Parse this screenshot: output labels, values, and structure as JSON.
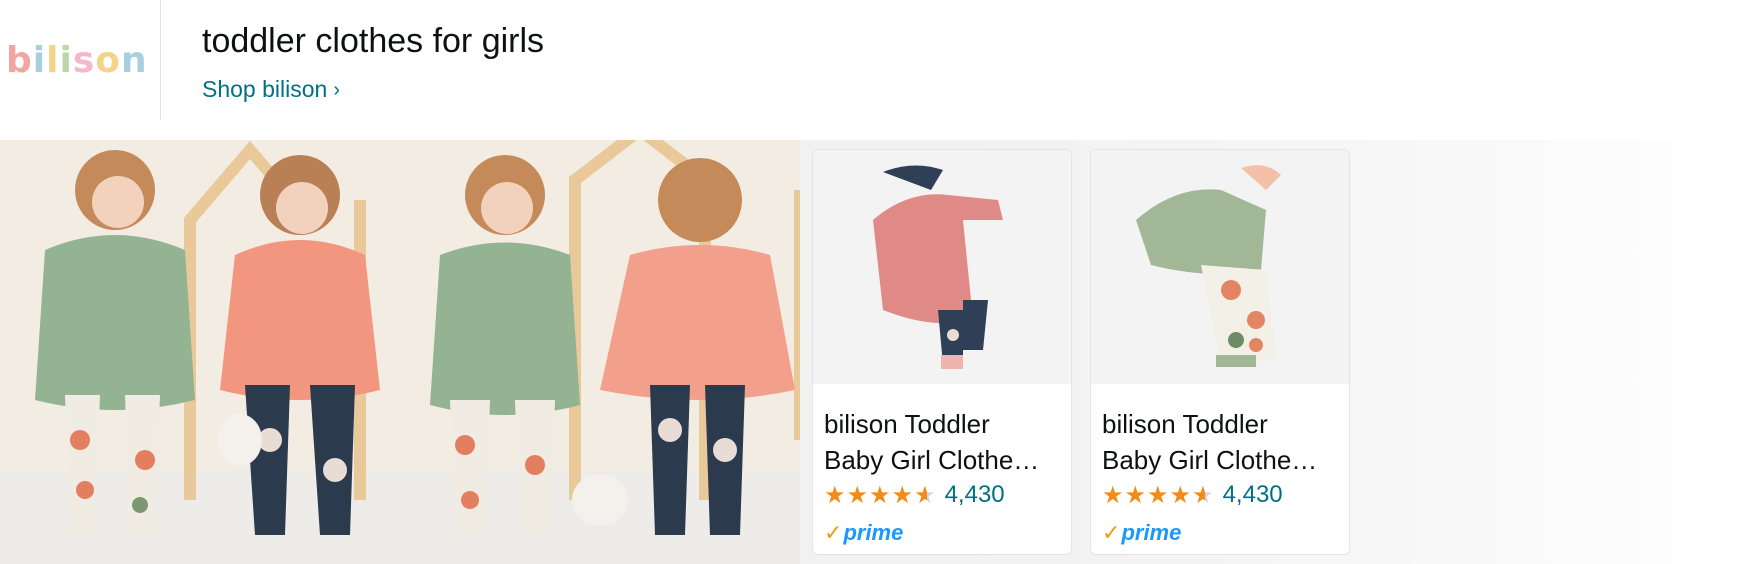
{
  "brand": {
    "logo_text": "bilison",
    "colors": [
      "#f0a7a0",
      "#a8cfe0",
      "#f2d48a",
      "#b9d7a8",
      "#f4b9c8",
      "#f2d48a",
      "#a8cfe0"
    ]
  },
  "header": {
    "title": "toddler clothes for girls",
    "shop_link": "Shop bilison",
    "shop_icon": "chevron-right-icon"
  },
  "hero": {
    "icon": "lifestyle-photo"
  },
  "products": [
    {
      "title_line1": "bilison Toddler",
      "title_line2": "Baby Girl Clothe…",
      "rating": 4.5,
      "review_count": "4,430",
      "prime": "prime",
      "image": "pink-dress-outfit"
    },
    {
      "title_line1": "bilison Toddler",
      "title_line2": "Baby Girl Clothe…",
      "rating": 4.5,
      "review_count": "4,430",
      "prime": "prime",
      "image": "green-dress-outfit"
    }
  ],
  "colors": {
    "link": "#007185",
    "star": "#f28c16",
    "prime": "#1a98ff"
  }
}
